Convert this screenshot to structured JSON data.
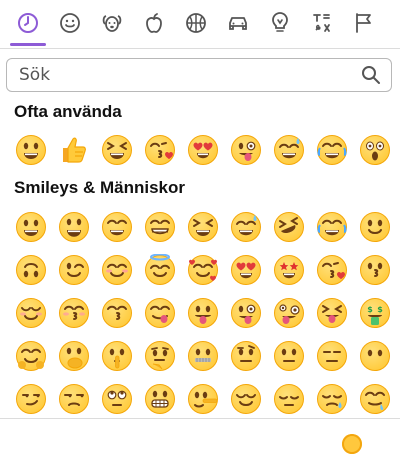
{
  "tabs": [
    {
      "icon": "clock-icon",
      "active": true
    },
    {
      "icon": "smiley-icon"
    },
    {
      "icon": "dog-icon"
    },
    {
      "icon": "apple-icon"
    },
    {
      "icon": "basketball-icon"
    },
    {
      "icon": "car-icon"
    },
    {
      "icon": "lightbulb-icon"
    },
    {
      "icon": "symbols-icon"
    },
    {
      "icon": "flag-icon"
    }
  ],
  "accent_color": "#8d5bd6",
  "search": {
    "placeholder": "Sök",
    "value": ""
  },
  "sections": {
    "frequent": {
      "title": "Ofta använda"
    },
    "smileys": {
      "title": "Smileys & Människor"
    }
  },
  "frequent_emojis": [
    "grin",
    "thumbs-up",
    "squint",
    "kiss-heart",
    "heart-eyes",
    "wink-tongue",
    "sweat-smile",
    "joy",
    "scream"
  ],
  "smiley_rows": [
    [
      "grin",
      "smiley",
      "grin-big",
      "beaming",
      "squint",
      "sweat-smile",
      "rofl",
      "joy",
      "slight-smile"
    ],
    [
      "upside-down",
      "wink",
      "blush",
      "halo",
      "hearts",
      "heart-eyes",
      "star-struck",
      "kiss-heart",
      "kiss"
    ],
    [
      "relaxed",
      "kiss-closed",
      "kiss-smile",
      "yum",
      "tongue",
      "wink-tongue",
      "zany",
      "squint-tongue",
      "money"
    ],
    [
      "hug",
      "hand-mouth",
      "shush",
      "thinking",
      "zipper",
      "raised-brow",
      "neutral",
      "expressionless",
      "no-mouth"
    ],
    [
      "smirk",
      "unamused",
      "eye-roll",
      "grimace",
      "lying",
      "relieved",
      "pensive",
      "sleepy",
      "drool"
    ]
  ],
  "skin_tone_color": "#ffc83d"
}
